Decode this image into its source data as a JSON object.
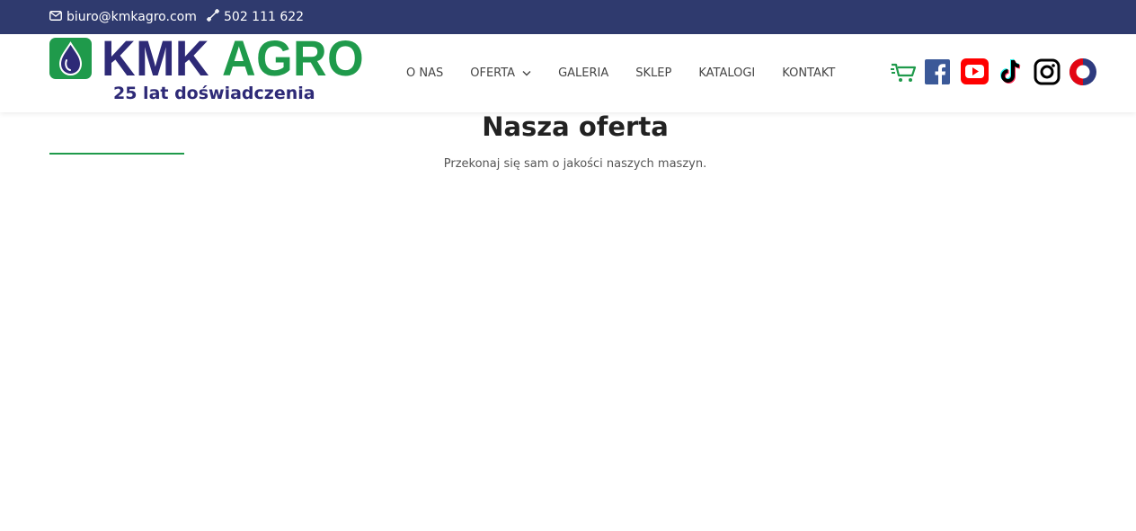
{
  "topbar": {
    "email": "biuro@kmkagro.com",
    "phone": "502 111 622",
    "email_icon": "envelope-icon",
    "phone_icon": "phone-icon"
  },
  "logo": {
    "brand_part1": "KMK",
    "brand_part2": "AGRO",
    "tagline": "25 lat doświadczenia"
  },
  "nav": {
    "items": [
      {
        "label": "O NAS"
      },
      {
        "label": "OFERTA",
        "has_dropdown": true
      },
      {
        "label": "GALERIA"
      },
      {
        "label": "SKLEP"
      },
      {
        "label": "KATALOGI"
      },
      {
        "label": "KONTAKT"
      }
    ]
  },
  "socials": [
    {
      "icon": "cart-icon"
    },
    {
      "icon": "facebook-icon"
    },
    {
      "icon": "youtube-icon"
    },
    {
      "icon": "tiktok-icon"
    },
    {
      "icon": "instagram-icon"
    },
    {
      "icon": "circle-brand-icon"
    }
  ],
  "main": {
    "title": "Nasza oferta",
    "subtitle": "Przekonaj się sam o jakości naszych maszyn."
  },
  "colors": {
    "topbar_bg": "#2f3a6e",
    "brand_blue": "#2e2a77",
    "brand_green": "#1f9a4b",
    "facebook": "#3b5998",
    "youtube": "#ff0000"
  }
}
